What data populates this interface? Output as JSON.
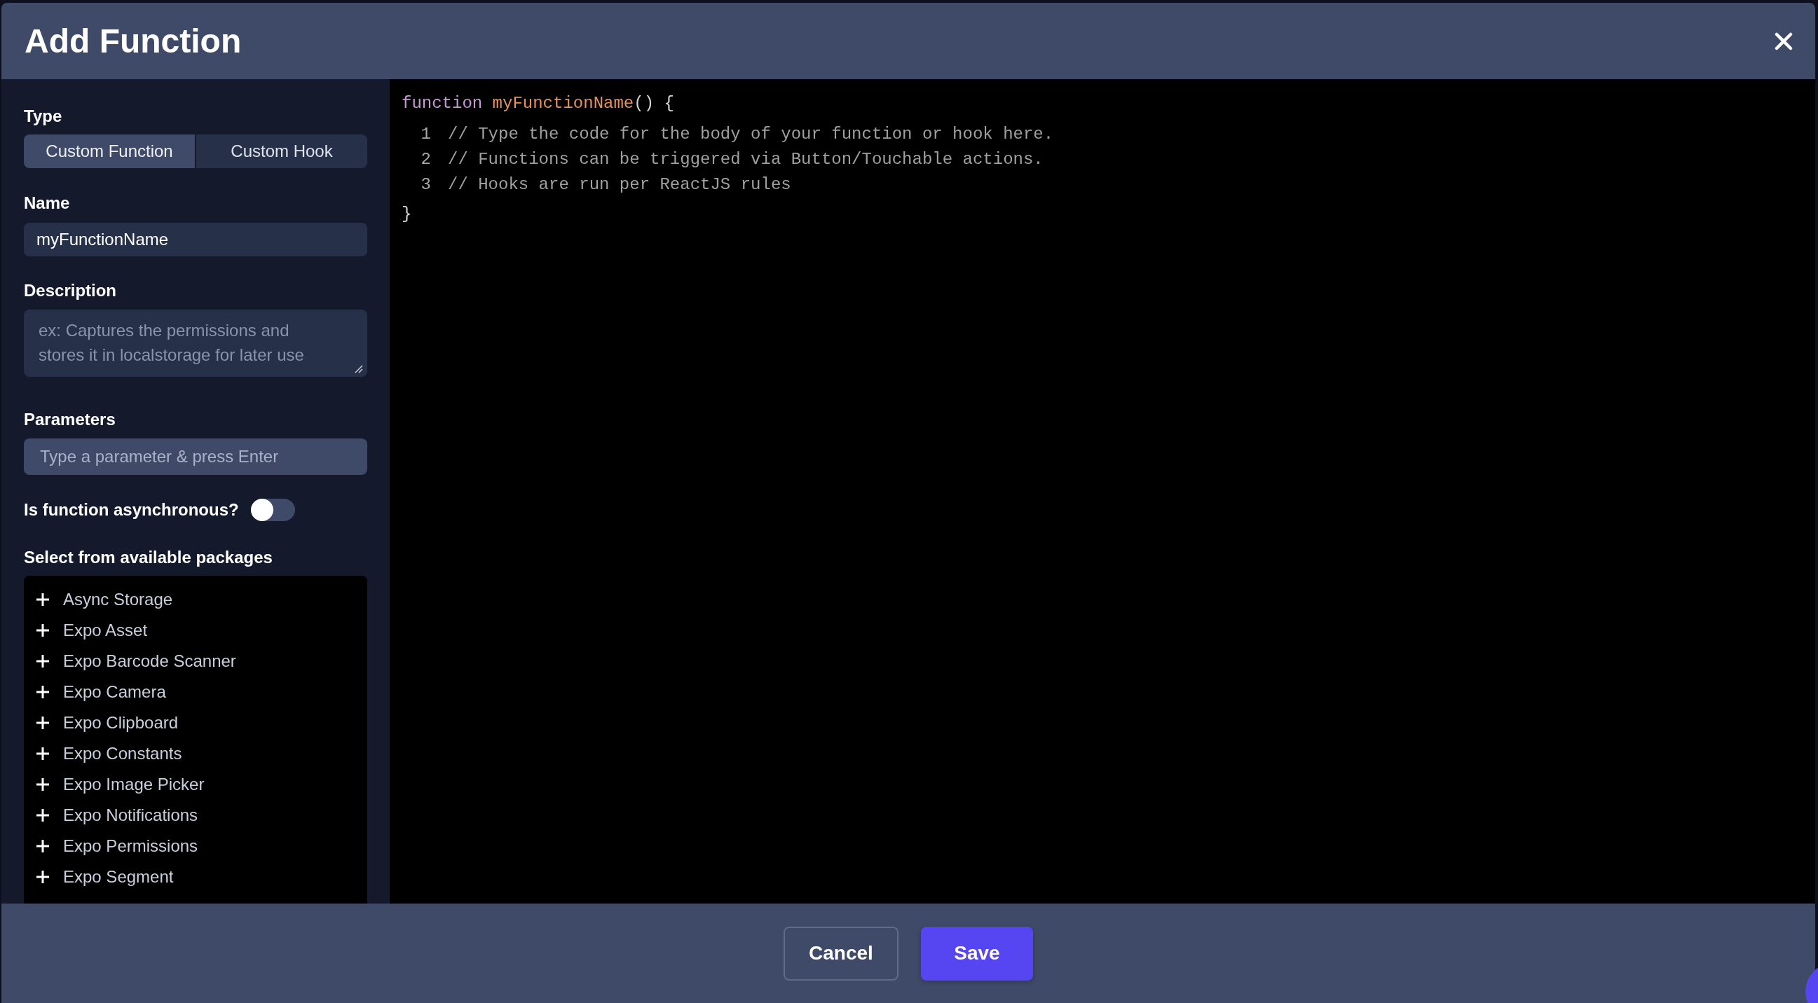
{
  "dialog": {
    "title": "Add Function"
  },
  "form": {
    "type": {
      "label": "Type",
      "options": [
        {
          "label": "Custom Function",
          "selected": true
        },
        {
          "label": "Custom Hook",
          "selected": false
        }
      ]
    },
    "name": {
      "label": "Name",
      "value": "myFunctionName"
    },
    "description": {
      "label": "Description",
      "placeholder": "ex: Captures the permissions and stores it in localstorage for later use"
    },
    "parameters": {
      "label": "Parameters",
      "placeholder": "Type a parameter & press Enter"
    },
    "async": {
      "label": "Is function asynchronous?",
      "on": false
    },
    "packages": {
      "label": "Select from available packages",
      "items": [
        "Async Storage",
        "Expo Asset",
        "Expo Barcode Scanner",
        "Expo Camera",
        "Expo Clipboard",
        "Expo Constants",
        "Expo Image Picker",
        "Expo Notifications",
        "Expo Permissions",
        "Expo Segment"
      ]
    }
  },
  "code_editor": {
    "signature": [
      {
        "kind": "keyword",
        "text": "function"
      },
      {
        "kind": "name",
        "text": "myFunctionName"
      },
      {
        "kind": "punctuation",
        "text": "() {"
      }
    ],
    "lines": [
      {
        "number": "1",
        "text": "// Type the code for the body of your function or hook here."
      },
      {
        "number": "2",
        "text": "// Functions can be triggered via Button/Touchable actions."
      },
      {
        "number": "3",
        "text": "// Hooks are run per ReactJS rules"
      }
    ],
    "closing": "}"
  },
  "footer": {
    "buttons": [
      {
        "label": "Cancel",
        "kind": "secondary"
      },
      {
        "label": "Save",
        "kind": "primary"
      }
    ]
  }
}
